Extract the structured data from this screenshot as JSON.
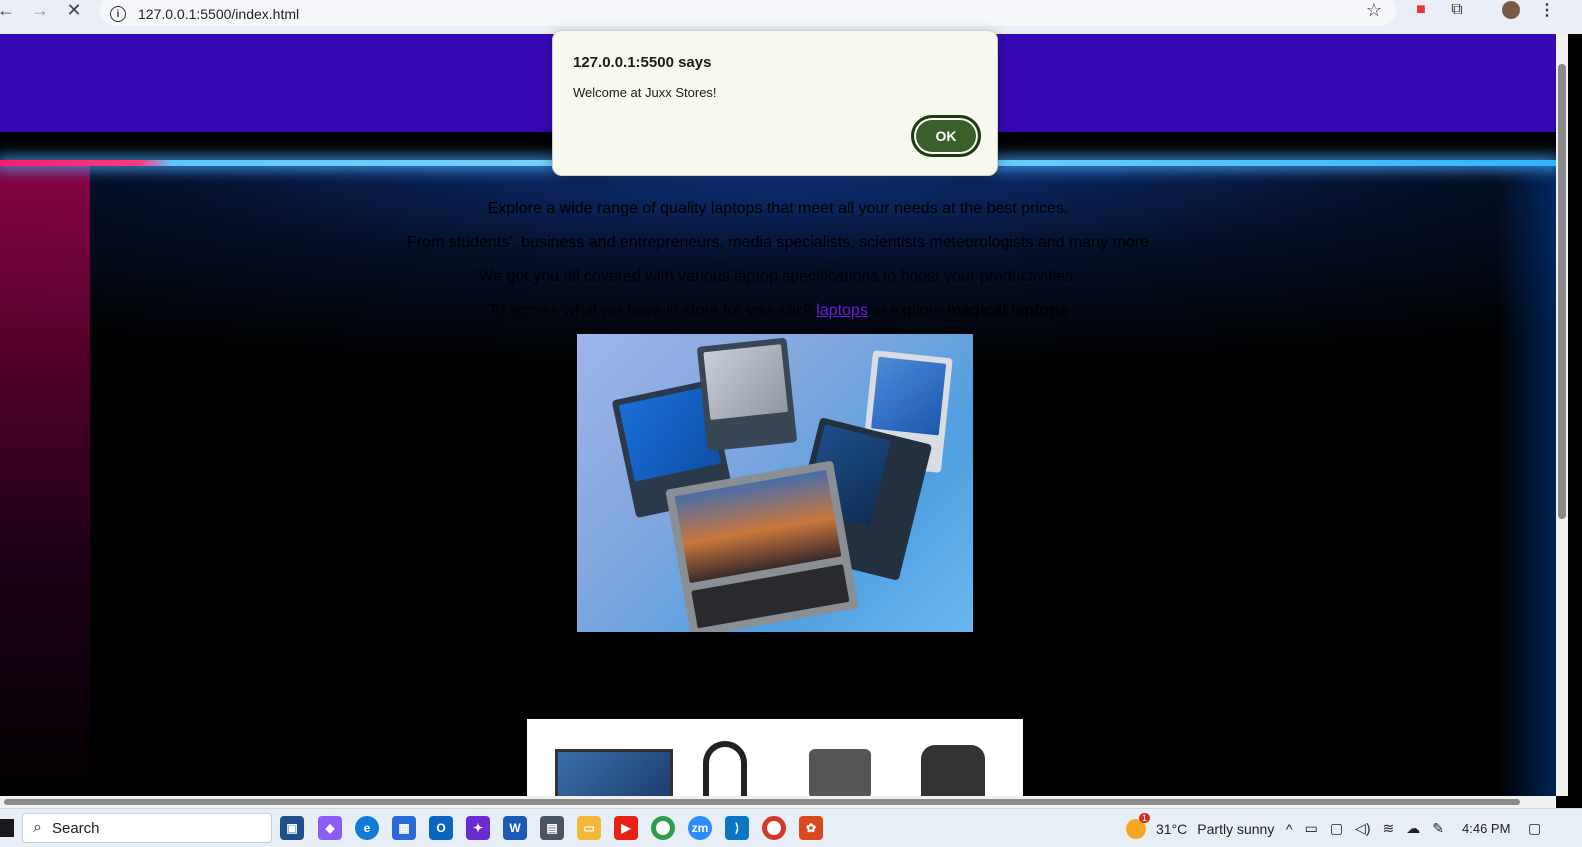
{
  "browser": {
    "url": "127.0.0.1:5500/index.html"
  },
  "page": {
    "line1": "Explore a wide range of quality laptops that meet all your needs at the best prices.",
    "line2": "From students', business and entrepreneurs, media specialists, scientists meteorologists and many more",
    "line3": "We got you all covered with various laptop specifications to boost your productivities.",
    "line4_prefix": "To access what we have in store for you, click ",
    "line4_link": "laptops",
    "line4_middle": " to explore ",
    "line4_bold": "magical laptops"
  },
  "dialog": {
    "title": "127.0.0.1:5500 says",
    "message": "Welcome at Juxx Stores!",
    "ok_label": "OK"
  },
  "taskbar": {
    "search_label": "Search",
    "weather": "31°C",
    "weather_desc": "Partly sunny",
    "time": "4:46 PM",
    "notification_count": "1"
  },
  "colors": {
    "header": "#3608b4",
    "link": "#6b1cd6",
    "ok_button": "#3b5f2b"
  }
}
